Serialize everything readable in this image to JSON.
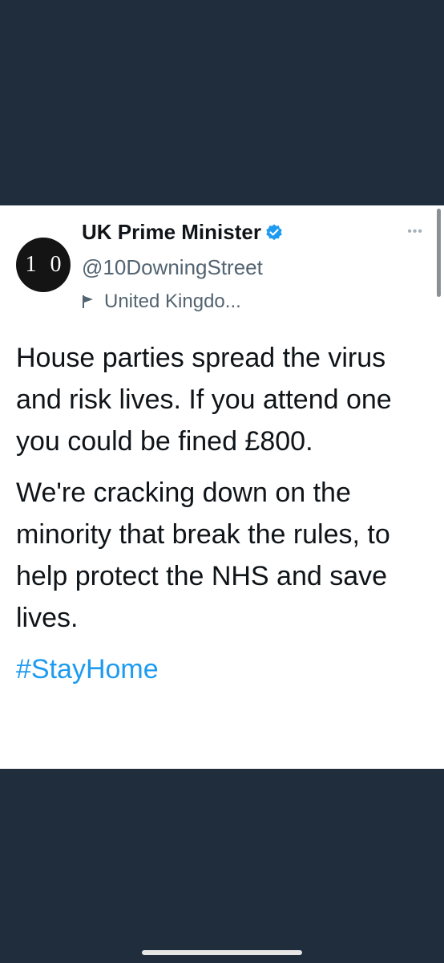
{
  "tweet": {
    "avatar_text": "1 0",
    "display_name": "UK Prime Minister",
    "handle": "@10DowningStreet",
    "location": "United Kingdo...",
    "paragraph_1": "House parties spread the virus and risk lives. If you attend one you could be fined £800.",
    "paragraph_2": "We're cracking down on the minority that break the rules, to help protect the NHS and save lives.",
    "hashtag": "#StayHome",
    "more_label": "•••"
  },
  "colors": {
    "background": "#1f2d3d",
    "card": "#ffffff",
    "text": "#0f1419",
    "secondary_text": "#536471",
    "link": "#1d9bf0",
    "verified": "#1d9bf0"
  },
  "icons": {
    "verified": "verified-badge-icon",
    "location": "flag-icon",
    "more": "more-options-icon"
  }
}
